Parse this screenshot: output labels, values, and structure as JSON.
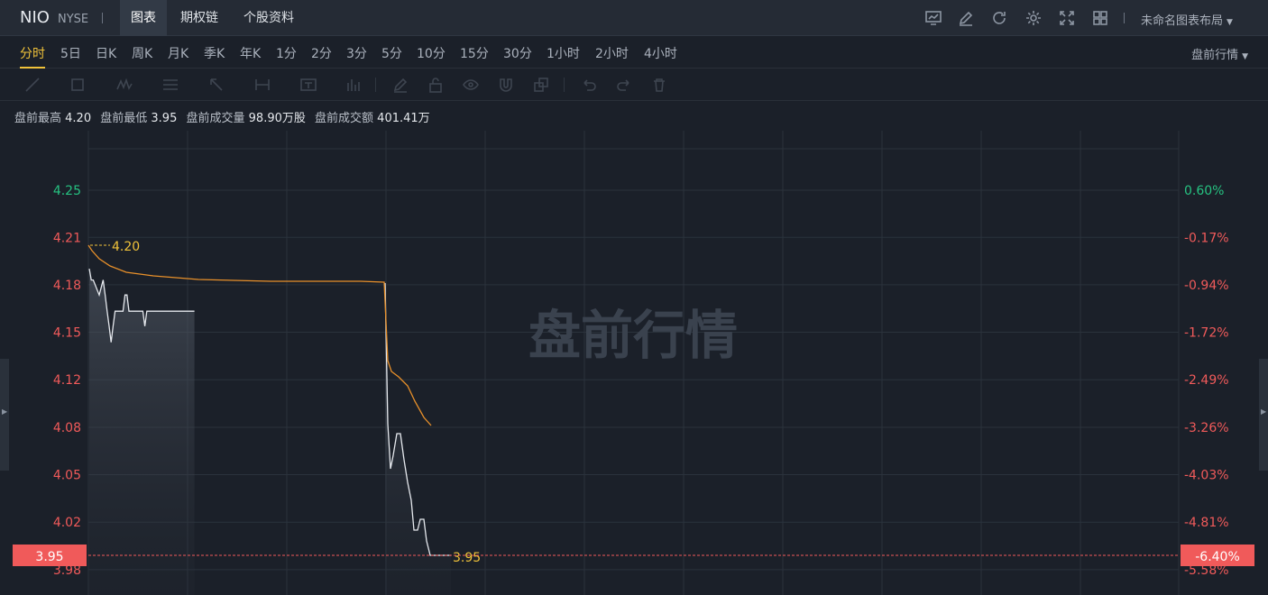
{
  "header": {
    "ticker": "NIO",
    "exchange": "NYSE",
    "tabs": [
      {
        "label": "图表",
        "active": true
      },
      {
        "label": "期权链",
        "active": false
      },
      {
        "label": "个股资料",
        "active": false
      }
    ],
    "layout_label": "未命名图表布局",
    "icons": [
      "chart-monitor-icon",
      "edit-icon",
      "refresh-icon",
      "settings-gear-icon",
      "fullscreen-icon",
      "grid-layout-icon"
    ]
  },
  "periods": [
    {
      "label": "分时",
      "active": true
    },
    {
      "label": "5日"
    },
    {
      "label": "日K"
    },
    {
      "label": "周K"
    },
    {
      "label": "月K"
    },
    {
      "label": "季K"
    },
    {
      "label": "年K"
    },
    {
      "label": "1分"
    },
    {
      "label": "2分"
    },
    {
      "label": "3分"
    },
    {
      "label": "5分"
    },
    {
      "label": "10分"
    },
    {
      "label": "15分"
    },
    {
      "label": "30分"
    },
    {
      "label": "1小时"
    },
    {
      "label": "2小时"
    },
    {
      "label": "4小时"
    }
  ],
  "session_selector": "盘前行情",
  "drawing_tools": [
    "line-tool-icon",
    "rectangle-tool-icon",
    "wave-tool-icon",
    "fibonacci-tool-icon",
    "arrow-tool-icon",
    "measure-tool-icon",
    "text-tool-icon",
    "volume-profile-icon",
    "pen-icon",
    "lock-icon",
    "eye-icon",
    "magnet-icon",
    "copy-icon",
    "undo-icon",
    "redo-icon",
    "trash-icon"
  ],
  "stats": {
    "high_label": "盘前最高",
    "high": "4.20",
    "low_label": "盘前最低",
    "low": "3.95",
    "volume_label": "盘前成交量",
    "volume": "98.90万股",
    "turnover_label": "盘前成交额",
    "turnover": "401.41万"
  },
  "colors": {
    "up": "#26c281",
    "down": "#f05a5a",
    "price_line": "#e6e9ee",
    "avg_line": "#e8902a",
    "highlight": "#f0c23a"
  },
  "chart_data": {
    "type": "line",
    "watermark": "盘前行情",
    "ylim": [
      3.9326,
      4.2842
    ],
    "y_ticks_left": [
      "4.25",
      "4.21",
      "4.18",
      "4.15",
      "4.12",
      "4.08",
      "4.05",
      "4.02",
      "3.98"
    ],
    "y_tick_values": [
      4.25,
      4.2122,
      4.1742,
      4.1361,
      4.098,
      4.0599,
      4.0219,
      3.9838,
      3.9457
    ],
    "y_ticks_right": [
      "0.60%",
      "-0.17%",
      "-0.94%",
      "-1.72%",
      "-2.49%",
      "-3.26%",
      "-4.03%",
      "-4.81%",
      "-5.58%"
    ],
    "current_price": "3.95",
    "current_value": 3.908,
    "current_pct": "-6.40%",
    "high_marker": "4.20",
    "high_value": 4.187,
    "low_marker": "3.95",
    "x_count": 100,
    "series": [
      {
        "values_role": "price",
        "x": [
          0,
          1,
          2,
          5,
          7,
          8,
          9,
          10,
          11,
          12,
          13,
          14,
          15,
          17,
          18,
          19,
          20,
          21,
          22,
          23,
          24,
          25,
          27,
          28,
          29,
          30,
          31,
          32,
          33,
          34,
          35,
          37,
          38,
          39,
          40,
          41,
          42,
          43,
          44,
          45,
          46,
          47,
          48,
          49,
          50,
          51,
          52,
          53
        ],
        "values": [
          4.187,
          4.178,
          4.178,
          4.166,
          4.178,
          4.166,
          4.153,
          4.141,
          4.128,
          4.141,
          4.153,
          4.153,
          4.153,
          4.153,
          4.166,
          4.166,
          4.153,
          4.153,
          4.153,
          4.153,
          4.153,
          4.153,
          4.153,
          4.141,
          4.153,
          4.153,
          4.153,
          4.153,
          4.153,
          4.153,
          4.153,
          4.153,
          4.153,
          4.153,
          4.153,
          4.153,
          4.153,
          4.153,
          4.153,
          4.153,
          4.153,
          4.153,
          4.153,
          4.153,
          4.153,
          4.153,
          4.153,
          4.153
        ]
      },
      {
        "values_role": "average",
        "x": [
          0,
          2,
          5,
          10,
          20,
          30,
          40,
          50,
          54,
          55,
          56,
          57,
          58
        ],
        "values": [
          4.186,
          4.178,
          4.166,
          4.16,
          4.158,
          4.157,
          4.156,
          4.155,
          4.154,
          4.08,
          4.065,
          4.06,
          4.05
        ]
      }
    ]
  }
}
